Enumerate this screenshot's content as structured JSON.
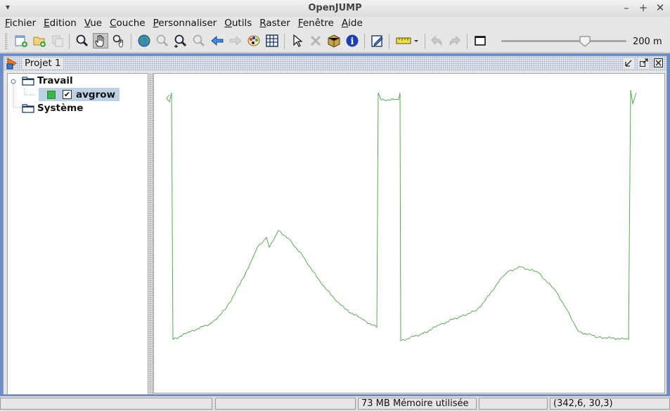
{
  "window": {
    "title": "OpenJUMP",
    "controls": [
      "–",
      "+",
      "✕"
    ]
  },
  "menu": [
    "Fichier",
    "Edition",
    "Vue",
    "Couche",
    "Personnaliser",
    "Outils",
    "Raster",
    "Fenêtre",
    "Aide"
  ],
  "toolbar": {
    "scale_label": "200 m",
    "zoom_slider_value": 0.67,
    "icons": [
      "new-category-icon",
      "open-project-icon",
      "copy-layer-icon",
      "zoom-icon",
      "pan-icon",
      "zoom-pan-icon",
      "globe-icon",
      "zoom-selected-icon",
      "zoom-in-icon",
      "zoom-out-icon",
      "previous-view-icon",
      "next-view-icon",
      "layer-style-icon",
      "grid-icon",
      "select-icon",
      "delete-icon",
      "box-icon",
      "info-icon",
      "edit-icon",
      "measure-icon",
      "undo-icon",
      "redo-icon",
      "window-icon"
    ]
  },
  "internal_frame": {
    "title": "Projet 1"
  },
  "tree": {
    "categories": [
      {
        "name": "Travail",
        "layers": [
          {
            "name": "avgrow",
            "checked": true,
            "color": "#3bb34a"
          }
        ]
      },
      {
        "name": "Système",
        "layers": []
      }
    ]
  },
  "map": {
    "line_color": "#5aaa55"
  },
  "status": {
    "message": "",
    "extra": "",
    "memory": "73 MB Mémoire utilisée",
    "field4": "",
    "coords": "(342,6,  30,3)"
  }
}
